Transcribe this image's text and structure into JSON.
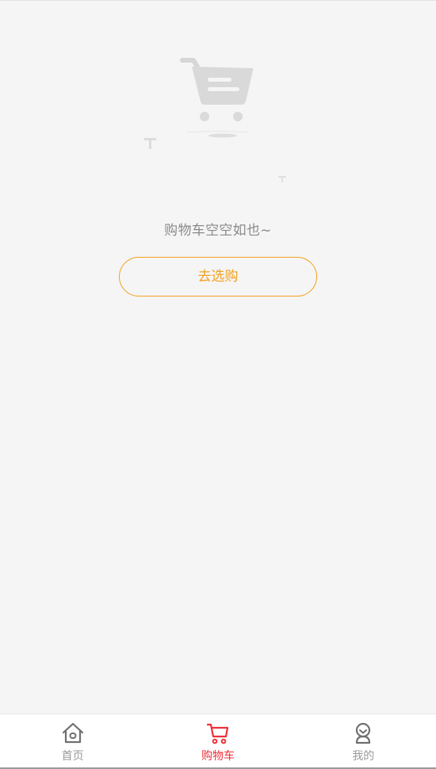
{
  "empty_state": {
    "message": "购物车空空如也~",
    "action_label": "去选购"
  },
  "tabbar": {
    "tabs": [
      {
        "label": "首页",
        "icon": "home-icon",
        "active": false
      },
      {
        "label": "购物车",
        "icon": "cart-icon",
        "active": true
      },
      {
        "label": "我的",
        "icon": "profile-icon",
        "active": false
      }
    ]
  },
  "colors": {
    "accent_orange": "#f3a01f",
    "active_red": "#f0303a",
    "inactive_gray": "#9a9a9a",
    "background": "#f5f5f5"
  }
}
